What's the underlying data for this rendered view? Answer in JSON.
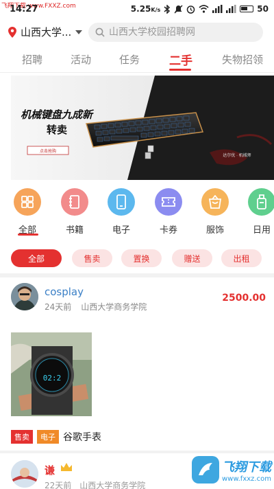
{
  "status": {
    "time": "14:27",
    "speed": "5.25",
    "speed_unit": "K/s",
    "battery": "50",
    "watermark": "飞翔下载 www.FXXZ.com"
  },
  "header": {
    "location": "山西大学...",
    "search_placeholder": "山西大学校园招聘网"
  },
  "tabs": [
    {
      "label": "招聘",
      "active": false
    },
    {
      "label": "活动",
      "active": false
    },
    {
      "label": "任务",
      "active": false
    },
    {
      "label": "二手",
      "active": true
    },
    {
      "label": "失物招领",
      "active": false
    }
  ],
  "banner": {
    "title_line1": "机械键盘九成新",
    "title_line2": "转卖",
    "button": "点击抢购",
    "corner_text": "达尔优 · 机械师"
  },
  "categories": [
    {
      "label": "全部",
      "icon": "grid-icon",
      "color": "#f6a45a",
      "active": true
    },
    {
      "label": "书籍",
      "icon": "notebook-icon",
      "color": "#f28b8b",
      "active": false
    },
    {
      "label": "电子",
      "icon": "phone-icon",
      "color": "#5cb8ee",
      "active": false
    },
    {
      "label": "卡券",
      "icon": "ticket-icon",
      "color": "#8b8cf0",
      "active": false
    },
    {
      "label": "服饰",
      "icon": "bag-icon",
      "color": "#f6b45a",
      "active": false
    },
    {
      "label": "日用",
      "icon": "bottle-icon",
      "color": "#5fcf8e",
      "active": false
    }
  ],
  "filters": [
    {
      "label": "全部",
      "active": true
    },
    {
      "label": "售卖",
      "active": false
    },
    {
      "label": "置换",
      "active": false
    },
    {
      "label": "赠送",
      "active": false
    },
    {
      "label": "出租",
      "active": false
    }
  ],
  "posts": [
    {
      "user": "cosplay",
      "time_ago": "24天前",
      "school": "山西大学商务学院",
      "price": "2500.00",
      "watch_time": "02:2",
      "tags": [
        "售卖",
        "电子"
      ],
      "title": "谷歌手表"
    },
    {
      "user": "谦",
      "meta": "22天前　山西大学商务学院"
    }
  ],
  "watermark_br": {
    "title": "飞翔下载",
    "url": "www.fxxz.com"
  }
}
